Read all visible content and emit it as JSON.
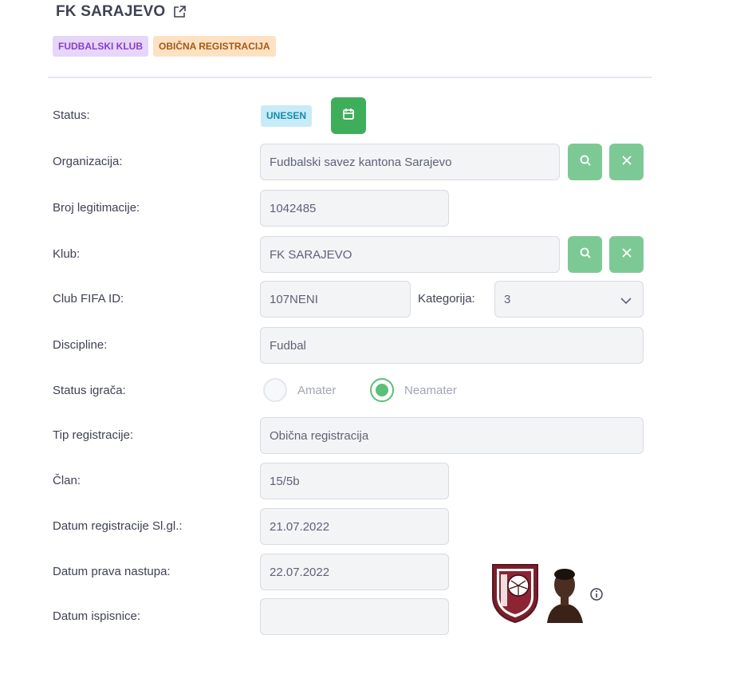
{
  "header": {
    "title": "FK SARAJEVO",
    "badges": [
      "FUDBALSKI KLUB",
      "OBIČNA REGISTRACIJA"
    ]
  },
  "form": {
    "status": {
      "label": "Status:",
      "value": "UNESEN"
    },
    "organizacija": {
      "label": "Organizacija:",
      "value": "Fudbalski savez kantona Sarajevo"
    },
    "broj_legitimacije": {
      "label": "Broj legitimacije:",
      "value": "1042485"
    },
    "klub": {
      "label": "Klub:",
      "value": "FK SARAJEVO"
    },
    "club_fifa_id": {
      "label": "Club FIFA ID:",
      "value": "107NENI"
    },
    "kategorija": {
      "label": "Kategorija:",
      "value": "3"
    },
    "discipline": {
      "label": "Discipline:",
      "value": "Fudbal"
    },
    "status_igraca": {
      "label": "Status igrača:",
      "options": [
        "Amater",
        "Neamater"
      ],
      "selected": "Neamater"
    },
    "tip_registracije": {
      "label": "Tip registracije:",
      "value": "Obična registracija"
    },
    "clan": {
      "label": "Član:",
      "value": "15/5b"
    },
    "datum_registracije": {
      "label": "Datum registracije Sl.gl.:",
      "value": "21.07.2022"
    },
    "datum_prava_nastupa": {
      "label": "Datum prava nastupa:",
      "value": "22.07.2022"
    },
    "datum_ispisnice": {
      "label": "Datum ispisnice:",
      "value": ""
    }
  },
  "colors": {
    "accent_green": "#3fae5a",
    "light_green": "#7dc995",
    "status_blue": "#168aad"
  },
  "icons": [
    "external-link-icon",
    "calendar-icon",
    "search-icon",
    "close-icon",
    "chevron-down-icon",
    "info-icon"
  ]
}
